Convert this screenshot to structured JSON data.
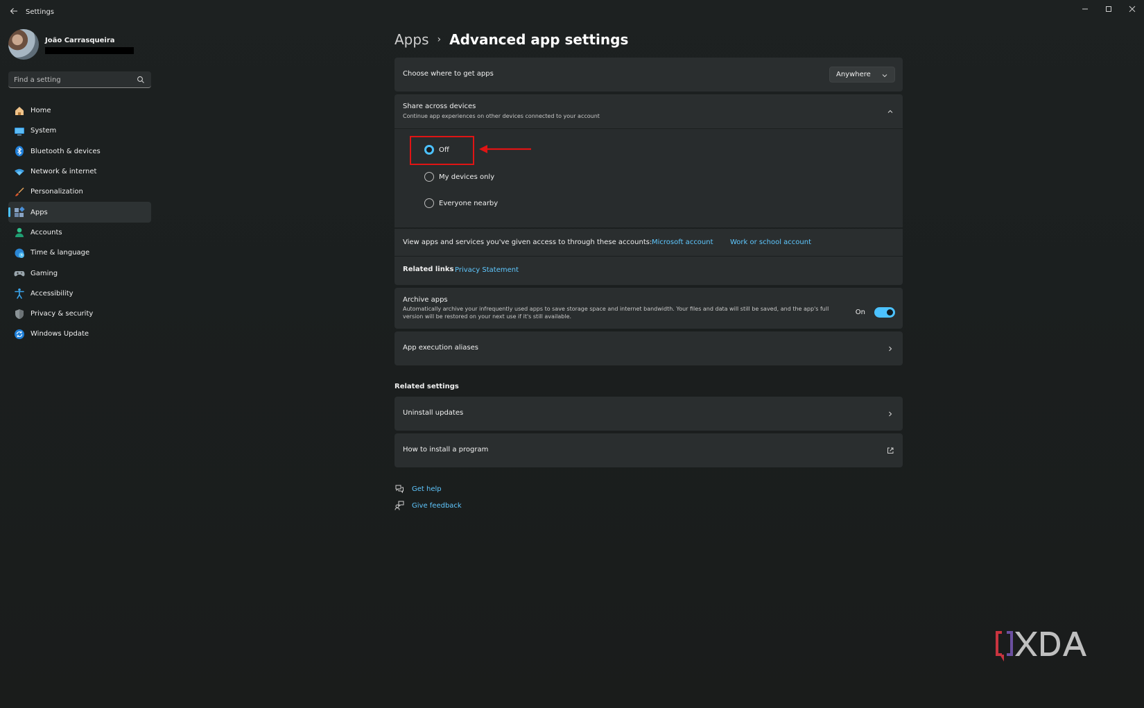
{
  "window": {
    "title": "Settings",
    "back_icon": "arrow-left-icon",
    "controls": [
      "minimize-icon",
      "maximize-icon",
      "close-icon"
    ]
  },
  "profile": {
    "name": "João Carrasqueira"
  },
  "search": {
    "placeholder": "Find a setting"
  },
  "sidebar": {
    "items": [
      {
        "label": "Home",
        "icon": "home-icon",
        "active": false
      },
      {
        "label": "System",
        "icon": "monitor-icon",
        "active": false
      },
      {
        "label": "Bluetooth & devices",
        "icon": "bluetooth-icon",
        "active": false
      },
      {
        "label": "Network & internet",
        "icon": "wifi-icon",
        "active": false
      },
      {
        "label": "Personalization",
        "icon": "brush-icon",
        "active": false
      },
      {
        "label": "Apps",
        "icon": "apps-icon",
        "active": true
      },
      {
        "label": "Accounts",
        "icon": "person-icon",
        "active": false
      },
      {
        "label": "Time & language",
        "icon": "globe-clock-icon",
        "active": false
      },
      {
        "label": "Gaming",
        "icon": "gamepad-icon",
        "active": false
      },
      {
        "label": "Accessibility",
        "icon": "accessibility-icon",
        "active": false
      },
      {
        "label": "Privacy & security",
        "icon": "shield-icon",
        "active": false
      },
      {
        "label": "Windows Update",
        "icon": "update-icon",
        "active": false
      }
    ]
  },
  "breadcrumb": {
    "parent": "Apps",
    "separator": "›",
    "current": "Advanced app settings"
  },
  "get_apps": {
    "label": "Choose where to get apps",
    "value": "Anywhere"
  },
  "share": {
    "title": "Share across devices",
    "description": "Continue app experiences on other devices connected to your account",
    "options": [
      {
        "label": "Off",
        "checked": true
      },
      {
        "label": "My devices only",
        "checked": false
      },
      {
        "label": "Everyone nearby",
        "checked": false
      }
    ],
    "accounts_text": "View apps and services you've given access to through these accounts:",
    "microsoft_account": "Microsoft account",
    "work_account": "Work or school account",
    "related_links_label": "Related links",
    "privacy_link": "Privacy Statement"
  },
  "archive": {
    "title": "Archive apps",
    "description": "Automatically archive your infrequently used apps to save storage space and internet bandwidth. Your files and data will still be saved, and the app's full version will be restored on your next use if it's still available.",
    "state_label": "On",
    "enabled": true
  },
  "aliases": {
    "label": "App execution aliases"
  },
  "related_settings": {
    "title": "Related settings",
    "uninstall_updates": "Uninstall updates",
    "how_to_install": "How to install a program"
  },
  "help": {
    "get_help": "Get help",
    "give_feedback": "Give feedback"
  },
  "watermark": {
    "text": "XDA"
  },
  "colors": {
    "accent": "#4cc2ff",
    "highlight": "#e01414",
    "card": "#2a2e2f"
  }
}
